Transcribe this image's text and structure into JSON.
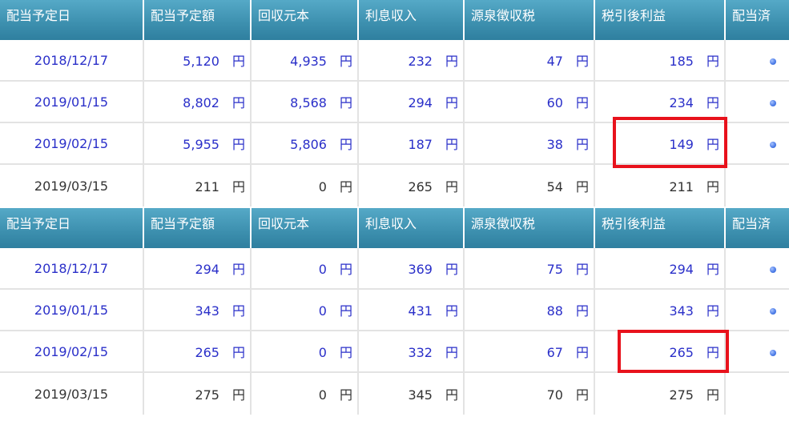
{
  "headers": [
    "配当予定日",
    "配当予定額",
    "回収元本",
    "利息収入",
    "源泉徴収税",
    "税引後利益",
    "配当済"
  ],
  "unit": "円",
  "tables": [
    {
      "rows": [
        {
          "date": "2018/12/17",
          "amount": "5,120",
          "principal": "4,935",
          "interest": "232",
          "tax": "47",
          "net": "185",
          "paid": true
        },
        {
          "date": "2019/01/15",
          "amount": "8,802",
          "principal": "8,568",
          "interest": "294",
          "tax": "60",
          "net": "234",
          "paid": true
        },
        {
          "date": "2019/02/15",
          "amount": "5,955",
          "principal": "5,806",
          "interest": "187",
          "tax": "38",
          "net": "149",
          "paid": true,
          "net_highlighted": true
        },
        {
          "date": "2019/03/15",
          "amount": "211",
          "principal": "0",
          "interest": "265",
          "tax": "54",
          "net": "211",
          "paid": false
        }
      ]
    },
    {
      "rows": [
        {
          "date": "2018/12/17",
          "amount": "294",
          "principal": "0",
          "interest": "369",
          "tax": "75",
          "net": "294",
          "paid": true
        },
        {
          "date": "2019/01/15",
          "amount": "343",
          "principal": "0",
          "interest": "431",
          "tax": "88",
          "net": "343",
          "paid": true
        },
        {
          "date": "2019/02/15",
          "amount": "265",
          "principal": "0",
          "interest": "332",
          "tax": "67",
          "net": "265",
          "paid": true,
          "net_highlighted": true
        },
        {
          "date": "2019/03/15",
          "amount": "275",
          "principal": "0",
          "interest": "345",
          "tax": "70",
          "net": "275",
          "paid": false
        }
      ]
    }
  ],
  "colors": {
    "header_bg": "#3c8fae",
    "header_text": "#ffffff",
    "paid_row_text": "#2a2fc9",
    "pending_row_text": "#333333",
    "highlight": "#e8121c",
    "paid_dot": "#4f7ee8"
  },
  "icons": {
    "paid": "paid-dot-icon"
  }
}
